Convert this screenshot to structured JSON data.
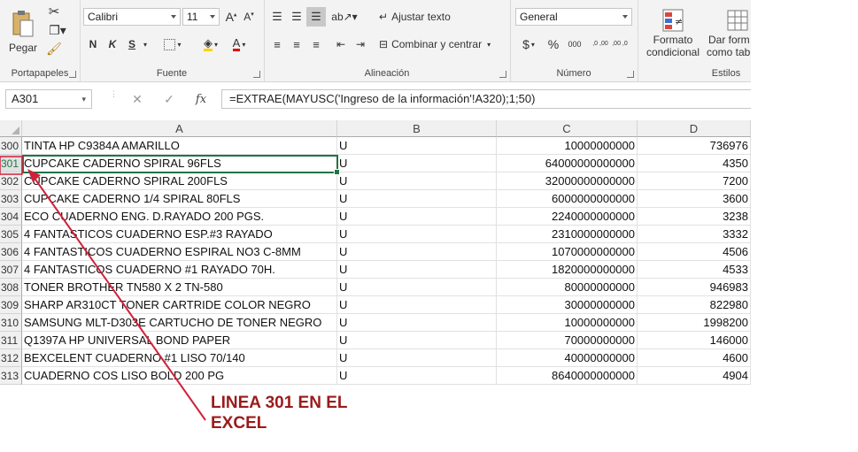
{
  "ribbon": {
    "clipboard": {
      "paste_label": "Pegar",
      "group_title": "Portapapeles"
    },
    "font": {
      "font_name": "Calibri",
      "font_size": "11",
      "bold": "N",
      "italic": "K",
      "underline": "S",
      "group_title": "Fuente"
    },
    "alignment": {
      "wrap_text": "Ajustar texto",
      "merge_center": "Combinar y centrar",
      "group_title": "Alineación"
    },
    "number": {
      "format": "General",
      "currency": "$",
      "percent": "%",
      "thousands": "000",
      "inc_decimal": ",0 ,00",
      "dec_decimal": ",00 ,0",
      "group_title": "Número"
    },
    "styles": {
      "conditional_format_l1": "Formato",
      "conditional_format_l2": "condicional",
      "format_table_l1": "Dar form",
      "format_table_l2": "como tab",
      "group_title": "Estilos"
    }
  },
  "formula_bar": {
    "name_box": "A301",
    "cancel": "✕",
    "enter": "✓",
    "fx": "fx",
    "formula": "=EXTRAE(MAYUSC('Ingreso de la información'!A320);1;50)"
  },
  "columns": [
    "A",
    "B",
    "C",
    "D"
  ],
  "rows": [
    {
      "num": "300",
      "a": "TINTA HP  C9384A AMARILLO",
      "b": "U",
      "c": "10000000000",
      "d": "736976"
    },
    {
      "num": "301",
      "a": "CUPCAKE CADERNO  SPIRAL  96FLS",
      "b": "U",
      "c": "64000000000000",
      "d": "4350"
    },
    {
      "num": "302",
      "a": "CUPCAKE CADERNO SPIRAL 200FLS",
      "b": "U",
      "c": "32000000000000",
      "d": "7200"
    },
    {
      "num": "303",
      "a": "CUPCAKE CADERNO  1/4 SPIRAL 80FLS",
      "b": "U",
      "c": "6000000000000",
      "d": "3600"
    },
    {
      "num": "304",
      "a": "ECO CUADERNO  ENG. D.RAYADO 200 PGS.",
      "b": "U",
      "c": "2240000000000",
      "d": "3238"
    },
    {
      "num": "305",
      "a": "4 FANTASTICOS CUADERNO ESP.#3 RAYADO",
      "b": "U",
      "c": "2310000000000",
      "d": "3332"
    },
    {
      "num": "306",
      "a": "4 FANTASTICOS CUADERNO ESPIRAL NO3 C-8MM",
      "b": "U",
      "c": "1070000000000",
      "d": "4506"
    },
    {
      "num": "307",
      "a": "4 FANTASTICOS CUADERNO #1 RAYADO 70H.",
      "b": "U",
      "c": "1820000000000",
      "d": "4533"
    },
    {
      "num": "308",
      "a": "TONER BROTHER TN580 X 2 TN-580",
      "b": "U",
      "c": "80000000000",
      "d": "946983"
    },
    {
      "num": "309",
      "a": "SHARP AR310CT TONER CARTRIDE COLOR NEGRO",
      "b": "U",
      "c": "30000000000",
      "d": "822980"
    },
    {
      "num": "310",
      "a": "SAMSUNG MLT-D303E CARTUCHO DE TONER NEGRO",
      "b": "U",
      "c": "10000000000",
      "d": "1998200"
    },
    {
      "num": "311",
      "a": "Q1397A HP UNIVERSAL BOND PAPER",
      "b": "U",
      "c": "70000000000",
      "d": "146000"
    },
    {
      "num": "312",
      "a": "BEXCELENT CUADERNO  #1 LISO 70/140",
      "b": "U",
      "c": "40000000000",
      "d": "4600"
    },
    {
      "num": "313",
      "a": "CUADERNO COS LISO BOLD 200 PG",
      "b": "U",
      "c": "8640000000000",
      "d": "4904"
    }
  ],
  "annotation": {
    "line1": "LINEA 301 EN EL",
    "line2": "EXCEL"
  },
  "colors": {
    "accent": "#217346",
    "annotation": "#9b1b1b",
    "arrow": "#d0213a"
  }
}
